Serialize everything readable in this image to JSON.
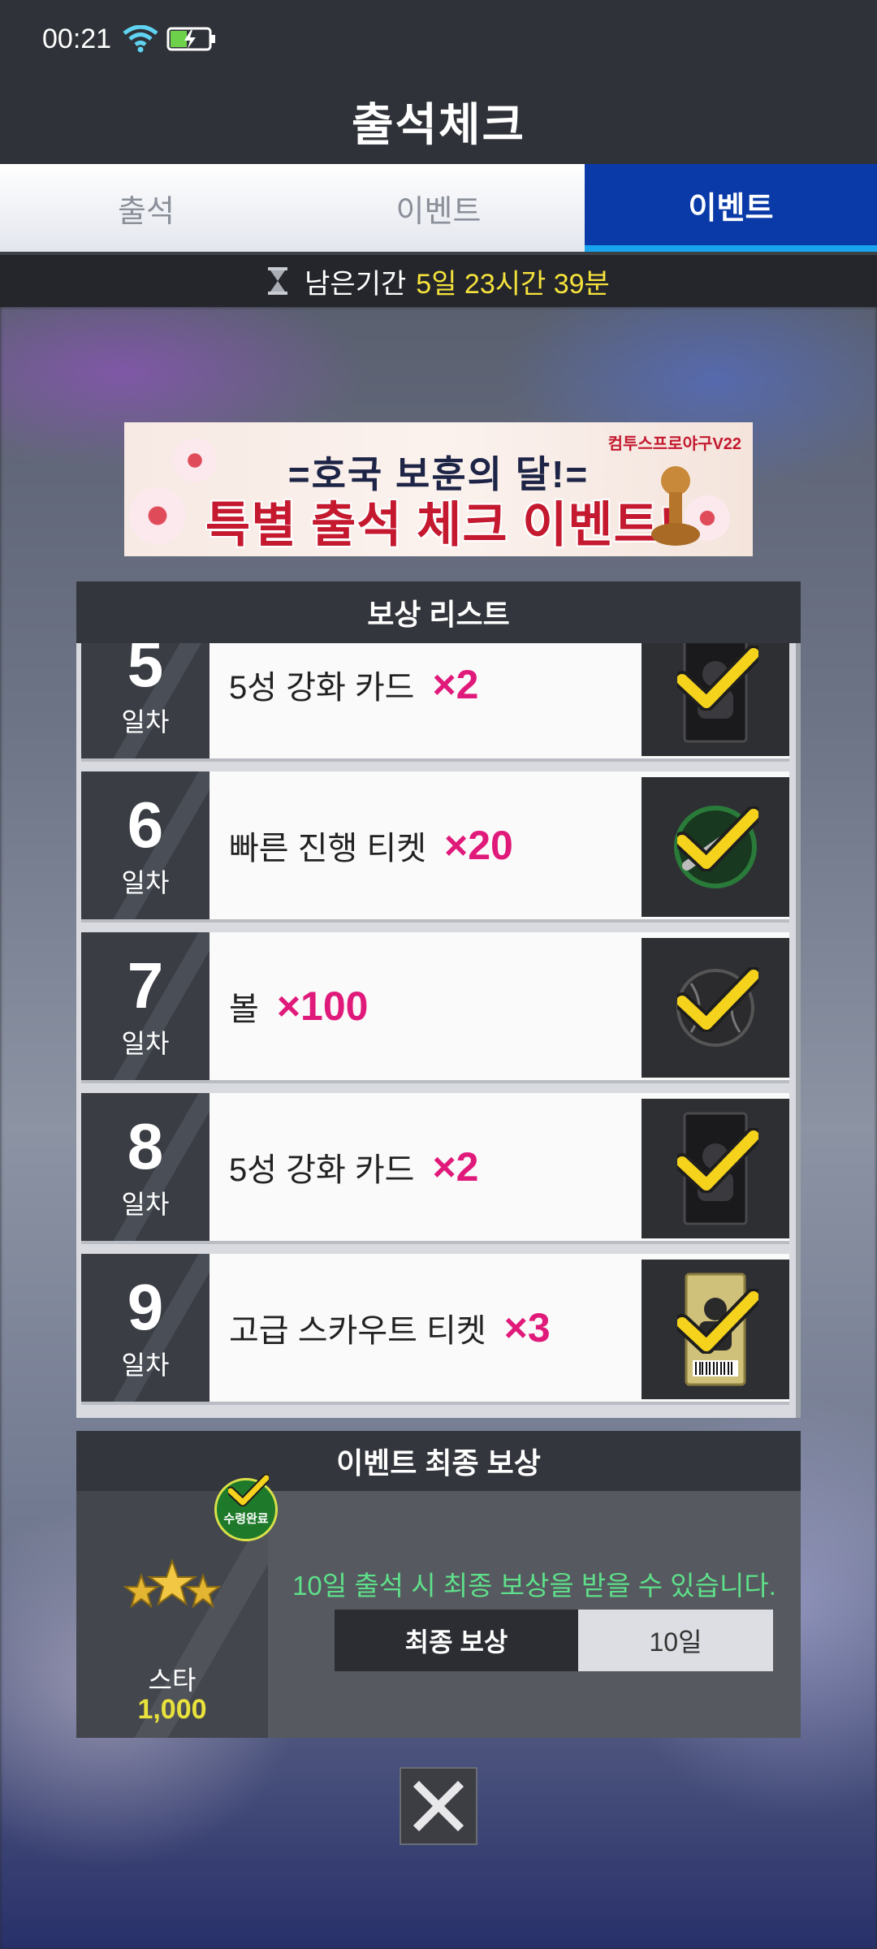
{
  "status_bar": {
    "time": "00:21"
  },
  "header": {
    "title": "출석체크"
  },
  "tabs": [
    {
      "label": "출석",
      "active": false
    },
    {
      "label": "이벤트",
      "active": false
    },
    {
      "label": "이벤트",
      "active": true
    }
  ],
  "remaining": {
    "label": "남은기간",
    "value": "5일 23시간 39분"
  },
  "banner": {
    "line1": "=호국 보훈의 달!=",
    "line2": "특별 출석 체크 이벤트!",
    "brand": "컴투스프로야구V22"
  },
  "reward_list": {
    "title": "보상 리스트",
    "day_unit": "일차",
    "items": [
      {
        "day": "5",
        "name": "5성 강화 카드",
        "qty": "×2",
        "icon": "enhance-card-icon",
        "claimed": true
      },
      {
        "day": "6",
        "name": "빠른 진행 티켓",
        "qty": "×20",
        "icon": "fast-ticket-icon",
        "claimed": true
      },
      {
        "day": "7",
        "name": "볼",
        "qty": "×100",
        "icon": "baseball-icon",
        "claimed": true
      },
      {
        "day": "8",
        "name": "5성 강화 카드",
        "qty": "×2",
        "icon": "enhance-card-icon",
        "claimed": true
      },
      {
        "day": "9",
        "name": "고급 스카우트 티켓",
        "qty": "×3",
        "icon": "scout-ticket-icon",
        "claimed": true
      }
    ]
  },
  "final_reward": {
    "title": "이벤트 최종 보상",
    "badge": "수령완료",
    "item_name": "스타",
    "item_qty": "1,000",
    "description": "10일 출석 시 최종 보상을 받을 수 있습니다.",
    "table_label": "최종 보상",
    "table_value": "10일"
  },
  "colors": {
    "accent_tab": "#0a3aa8",
    "tab_underline": "#19a4f0",
    "highlight_yellow": "#f5e23c",
    "qty_pink": "#e01a7a",
    "desc_green": "#5ee08a"
  }
}
